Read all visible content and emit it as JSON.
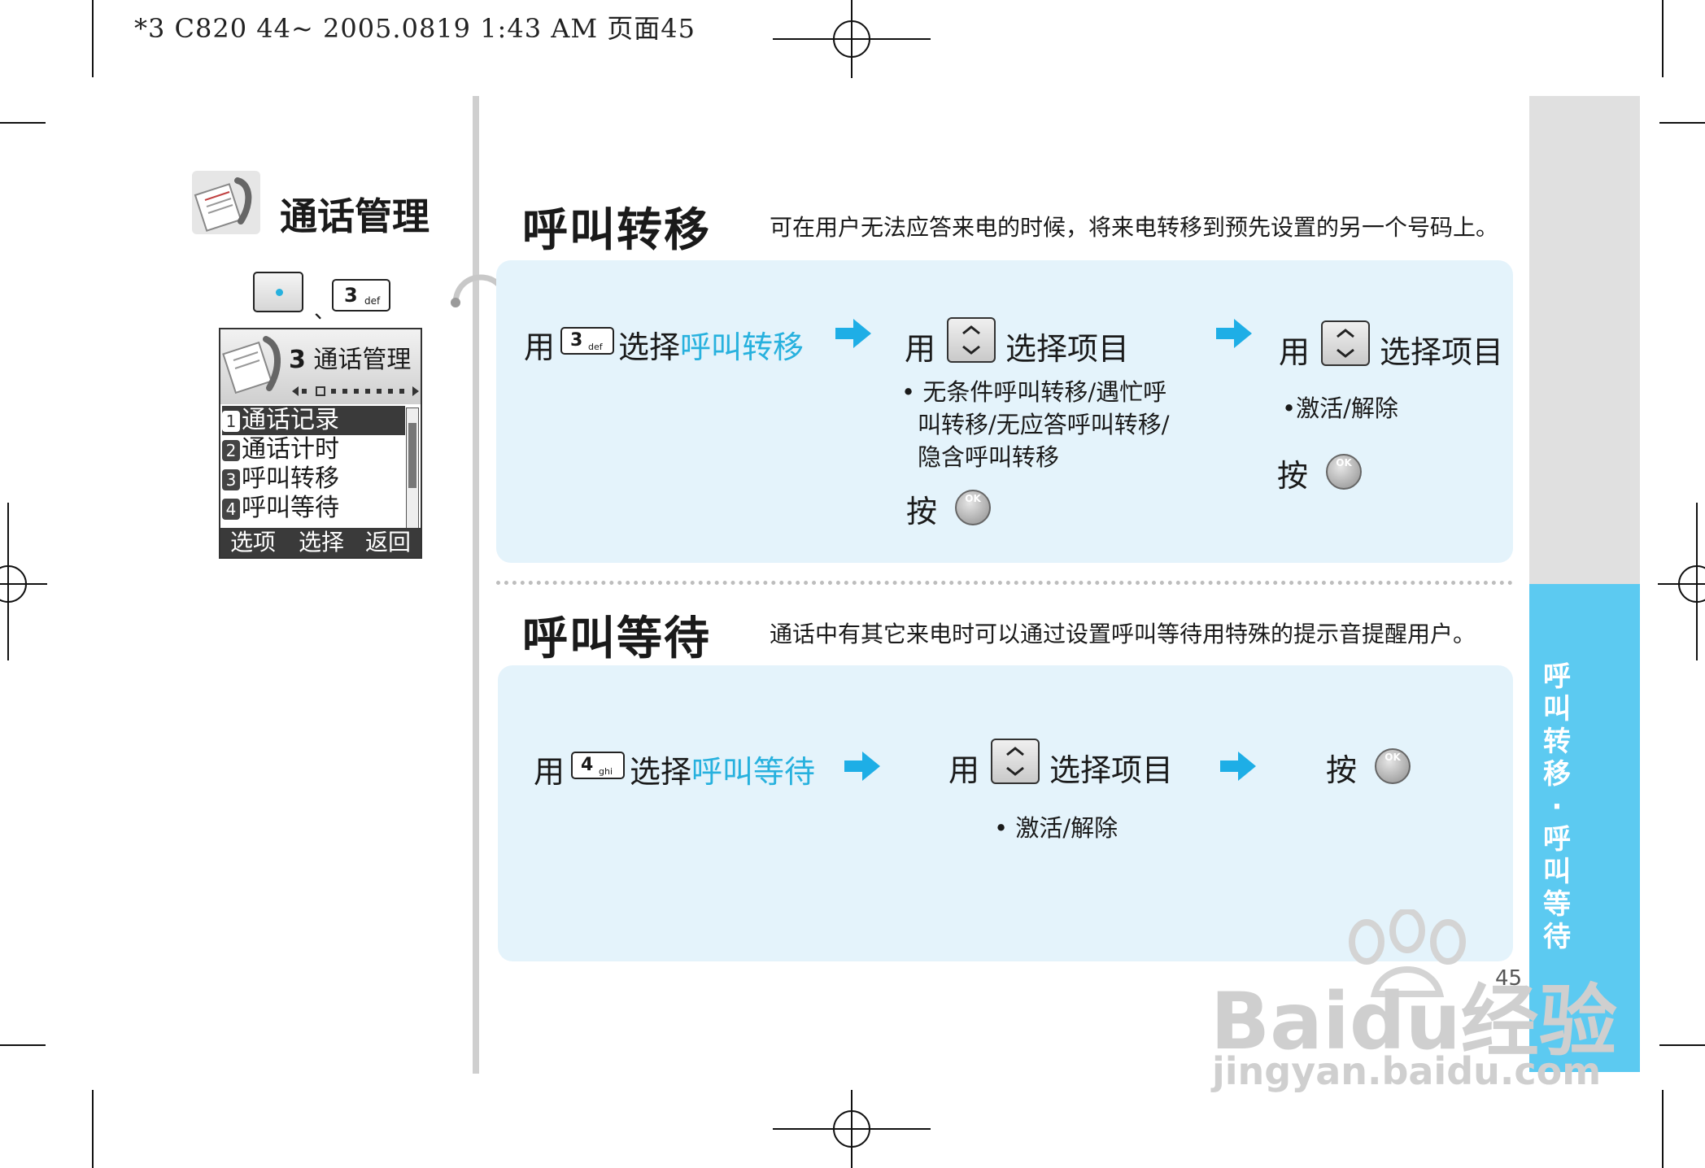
{
  "header": {
    "print_line": "*3 C820 44~ 2005.0819 1:43 AM 页面45"
  },
  "sidebar": {
    "section_title": "通话管理",
    "key_separator": "、",
    "key_3": {
      "num": "3",
      "sub": "def"
    },
    "phone": {
      "title_num": "3",
      "title": "通话管理",
      "items": [
        {
          "num": "1",
          "label": "通话记录"
        },
        {
          "num": "2",
          "label": "通话计时"
        },
        {
          "num": "3",
          "label": "呼叫转移"
        },
        {
          "num": "4",
          "label": "呼叫等待"
        }
      ],
      "softkeys": {
        "left": "选项",
        "center": "选择",
        "right": "返回"
      }
    }
  },
  "forwarding": {
    "title": "呼叫转移",
    "desc": "可在用户无法应答来电的时候，将来电转移到预先设置的另一个号码上。",
    "step1": {
      "use": "用",
      "key_num": "3",
      "key_sub": "def",
      "select": "选择",
      "highlight": "呼叫转移"
    },
    "step2": {
      "use": "用",
      "text": "选择项目",
      "bullet_lines": [
        "无条件呼叫转移/遇忙呼",
        "叫转移/无应答呼叫转移/",
        "隐含呼叫转移"
      ],
      "press": "按"
    },
    "step3": {
      "use": "用",
      "text": "选择项目",
      "bullet": "激活/解除",
      "press": "按"
    }
  },
  "waiting": {
    "title": "呼叫等待",
    "desc": "通话中有其它来电时可以通过设置呼叫等待用特殊的提示音提醒用户。",
    "step1": {
      "use": "用",
      "key_num": "4",
      "key_sub": "ghi",
      "select": "选择",
      "highlight": "呼叫等待"
    },
    "step2": {
      "use": "用",
      "text": "选择项目",
      "bullet": "激活/解除"
    },
    "step3": {
      "press": "按"
    }
  },
  "ok_label": "OK",
  "bullet_char": "•",
  "right_tab": {
    "text": "呼叫转移·呼叫等待"
  },
  "page_number": "45",
  "watermark": {
    "brand": "Baidu经验",
    "url": "jingyan.baidu.com"
  },
  "colors": {
    "highlight": "#27b1de",
    "panel": "#e4f3fb",
    "tab_blue": "#5ccaf1",
    "tab_grey": "#e0e0e0",
    "arrow": "#1eaee6"
  }
}
